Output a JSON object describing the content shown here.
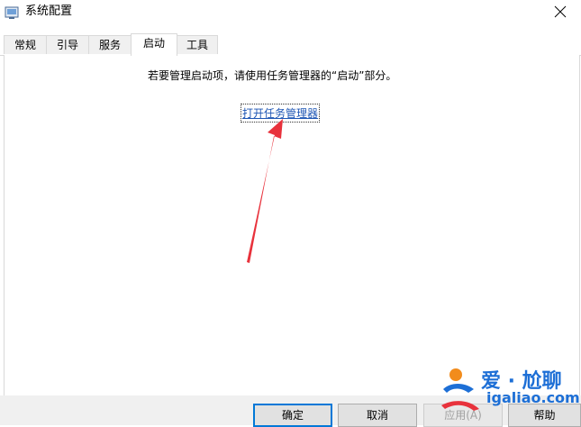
{
  "window": {
    "title": "系统配置",
    "close_icon": "close-icon",
    "app_icon": "msconfig-icon"
  },
  "tabs": [
    {
      "label": "常规",
      "active": false
    },
    {
      "label": "引导",
      "active": false
    },
    {
      "label": "服务",
      "active": false
    },
    {
      "label": "启动",
      "active": true
    },
    {
      "label": "工具",
      "active": false
    }
  ],
  "startup": {
    "description": "若要管理启动项，请使用任务管理器的“启动”部分。",
    "link_label": "打开任务管理器"
  },
  "buttons": {
    "ok": "确定",
    "cancel": "取消",
    "apply": "应用(A)",
    "help": "帮助"
  },
  "annotation": {
    "arrow_color": "#e8323c"
  },
  "watermark": {
    "line1": "爱 · 尬聊",
    "line2": "igaliao.com",
    "color": "#1d6fd6"
  }
}
